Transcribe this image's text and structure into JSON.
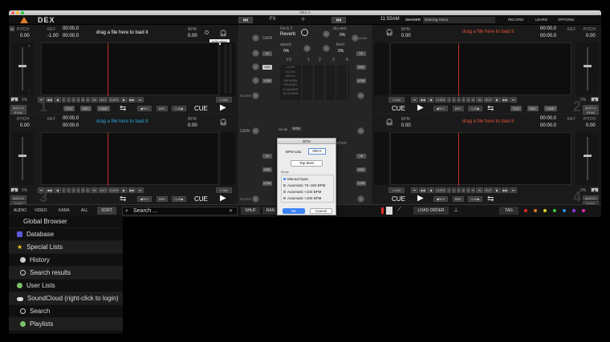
{
  "window": {
    "title": "DEX 3",
    "logo": "DEX"
  },
  "topbar": {
    "fx_tab": "FX",
    "clock": "11:55AM",
    "shader_label": "SHADER",
    "shader_value": "Dancing Sinus",
    "record": "RECORD",
    "learn": "LEARN",
    "options": "OPTIONS"
  },
  "deck_common": {
    "pitch": "PITCH",
    "key": "KEY",
    "bpm": "BPM",
    "drag_text": "drag a file here to load it",
    "time": "00:00.0",
    "zero": "0.00",
    "tcv": "TCV",
    "rel": "REL",
    "line": "LINE",
    "rev": "◀REV",
    "brk": "BRK",
    "cue_arrow": "CUE▶",
    "cue": "CUE",
    "cues": "CUES",
    "in": "IN",
    "out": "OUT",
    "load": "LOAD",
    "match": "MATCH",
    "sync": "SYNC",
    "pct": "0%",
    "hot": [
      "1",
      "2",
      "3",
      "4",
      "5",
      "6"
    ]
  },
  "deck1": {
    "number": "1",
    "pitch_val": "0.00",
    "key_val": "-1.00",
    "time1": "00:00.0",
    "time2": "00:00.0",
    "bpm_val": "0.00",
    "tooltip": "Edit BPM"
  },
  "deck2": {
    "number": "2"
  },
  "deck3": {
    "number": "3"
  },
  "deck4": {
    "number": "4"
  },
  "mixer": {
    "deck_label": "Deck 2",
    "effect": "Reverb",
    "dry_wet": "dry-wet",
    "dry_wet_val": "0%",
    "speed": "speed",
    "speed_val": "0%",
    "feed": "feed",
    "feed_val": "0%",
    "fx": "FX",
    "fx_slots": [
      "1",
      "2",
      "3",
      "4"
    ],
    "effects": [
      "LOOP",
      "ECHO",
      "DELAY",
      "REVERB",
      "PHASER",
      "FLANGER",
      "AUTOPAN"
    ],
    "gain": "GAIN",
    "hi": "HI",
    "mid": "MID",
    "low": "LOW",
    "filter": "FILTER",
    "master": "MASTER",
    "on_air": "on-air",
    "ntk": "NTK"
  },
  "dialog": {
    "title": "BPM",
    "bpm_label": "BPM valu",
    "bpm_value": "000.0",
    "tap_beat": "Tap Beat",
    "mode": "Mode",
    "options": [
      "Manual input",
      "Automatic 75~150 BPM",
      "Automatic <100 BPM",
      "Automatic >100 BPM"
    ],
    "selected": 0,
    "ok": "OK",
    "cancel": "Cancel"
  },
  "browser_bar": {
    "audio": "AUDIO",
    "video": "VIDEO",
    "kara": "KARA",
    "all": "ALL",
    "sort": "SORT",
    "search_placeholder": "Search ...",
    "shuf": "SHUF",
    "ran": "RAN",
    "load_order": "LOAD ORDER",
    "tag": "TAG"
  },
  "sidebar": {
    "items": [
      {
        "label": "Global Browser",
        "icon": "globe-icon"
      },
      {
        "label": "Database",
        "icon": "database-icon"
      },
      {
        "label": "Special Lists",
        "icon": "star-icon"
      },
      {
        "label": "History",
        "icon": "clock-icon"
      },
      {
        "label": "Search results",
        "icon": "search-icon"
      },
      {
        "label": "User Lists",
        "icon": "users-icon"
      },
      {
        "label": "SoundCloud (right-click to login)",
        "icon": "cloud-icon"
      },
      {
        "label": "Search",
        "icon": "search-icon"
      },
      {
        "label": "Playlists",
        "icon": "playlist-icon"
      }
    ]
  },
  "colors": {
    "drag_white": "#ffffff",
    "drag_blue": "#2aa7e0",
    "drag_red": "#e0503a",
    "tag_dots": [
      "#e02a2a",
      "#e07b2a",
      "#e0d02a",
      "#3ac84a",
      "#2a8ce0",
      "#8a3ae0",
      "#e02ab0"
    ]
  }
}
